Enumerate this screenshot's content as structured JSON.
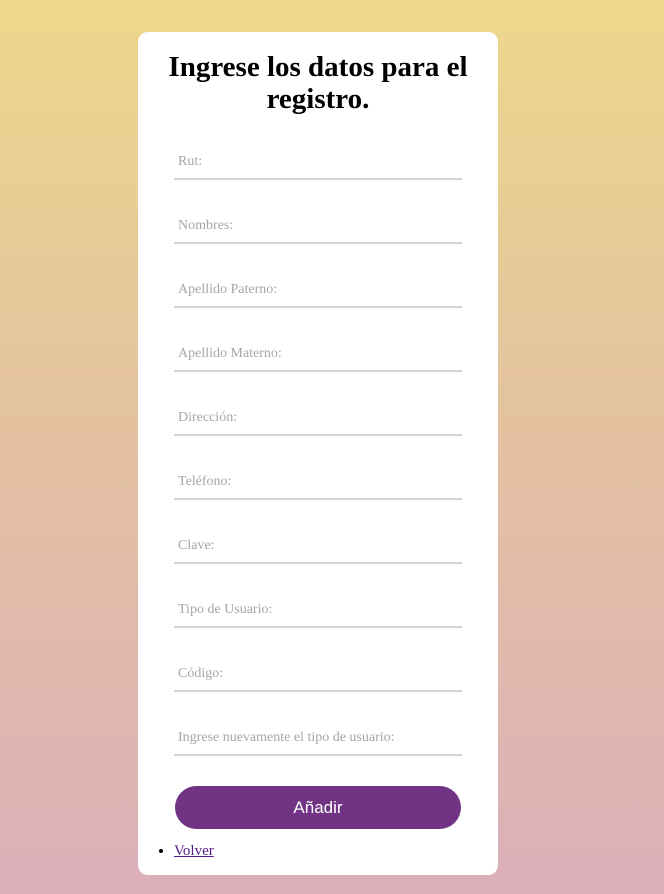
{
  "form": {
    "title": "Ingrese los datos para el registro.",
    "fields": [
      {
        "placeholder": "Rut:"
      },
      {
        "placeholder": "Nombres:"
      },
      {
        "placeholder": "Apellido Paterno:"
      },
      {
        "placeholder": "Apellido Materno:"
      },
      {
        "placeholder": "Dirección:"
      },
      {
        "placeholder": "Teléfono:"
      },
      {
        "placeholder": "Clave:"
      },
      {
        "placeholder": "Tipo de Usuario:"
      },
      {
        "placeholder": "Código:"
      },
      {
        "placeholder": "Ingrese nuevamente el tipo de usuario:"
      }
    ],
    "submit_label": "Añadir",
    "back_link": "Volver"
  },
  "colors": {
    "accent": "#713383",
    "gradient_top": "#eed78b",
    "gradient_bottom": "#dcafb9"
  }
}
